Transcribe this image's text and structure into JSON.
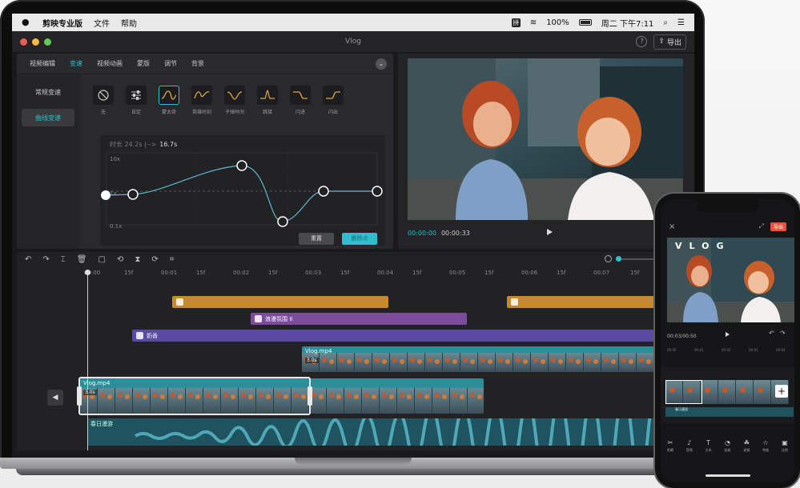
{
  "menubar": {
    "app_name": "剪映专业版",
    "menu_file": "文件",
    "menu_help": "帮助",
    "input_badge": "拼",
    "battery": "100%",
    "clock": "周二 下午7:11"
  },
  "window": {
    "title": "Vlog",
    "export_label": "导出"
  },
  "tabs": [
    "视频编辑",
    "变速",
    "视频动画",
    "蒙版",
    "调节",
    "背景"
  ],
  "side_nav": [
    "常规变速",
    "曲线变速"
  ],
  "presets": [
    "无",
    "自定",
    "蒙太奇",
    "英雄时刻",
    "子弹时间",
    "跳接",
    "闪进",
    "闪出"
  ],
  "curve": {
    "duration_label": "时长 24.2s |-->",
    "duration_new": "16.7s",
    "y_top": "10x",
    "y_mid": "1x",
    "y_bottom": "0.1x",
    "reset_label": "重置",
    "add_point_label": "删除点"
  },
  "preview": {
    "current_time": "00:00:00",
    "total_time": "00:00:33",
    "ratio_label": "原始"
  },
  "timeline": {
    "ruler": [
      "00:00",
      "15f",
      "00:01",
      "15f",
      "00:02",
      "15f",
      "00:03",
      "15f",
      "00:04",
      "15f",
      "00:05",
      "15f",
      "00:06",
      "15f",
      "00:07",
      "15f"
    ],
    "text_clip": "浪漫氛围 II",
    "audio_clip_1": "奶香",
    "video_top_label": "Vlog.mp4",
    "video_top_duration": "3.0s",
    "video_main_label": "Vlog.mp4",
    "video_main_duration": "3.0s",
    "music_label": "春日漫游"
  },
  "phone": {
    "export_label": "导出",
    "vlog_text": "VLOG",
    "time": "00:03/00:50",
    "ruler": [
      "00:00",
      "00:01",
      "00:02",
      "00:03",
      "00:04"
    ],
    "audio_label": "春日漫游",
    "nav": [
      {
        "icon": "✂",
        "label": "剪辑"
      },
      {
        "icon": "♪",
        "label": "音频"
      },
      {
        "icon": "T",
        "label": "文本"
      },
      {
        "icon": "◔",
        "label": "贴纸"
      },
      {
        "icon": "☘",
        "label": "滤镜"
      },
      {
        "icon": "☆",
        "label": "特效"
      },
      {
        "icon": "▣",
        "label": "比例"
      }
    ]
  },
  "colors": {
    "accent": "#2dbfcf",
    "sticker_track": "#c6892b",
    "text_track": "#7c4b9c",
    "audio_track": "#5a4aa3",
    "video_track": "#2a8f9b"
  }
}
